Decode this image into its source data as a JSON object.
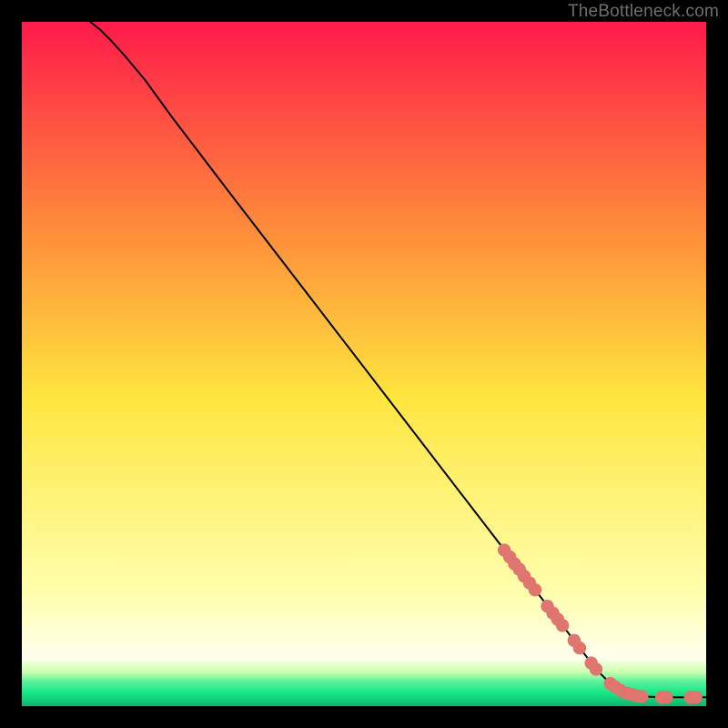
{
  "attribution": "TheBottleneck.com",
  "colors": {
    "top": "#ff1a4b",
    "mid_upper": "#ff8b3a",
    "mid": "#ffe63f",
    "mid_lower_pale": "#ffffb0",
    "green_band": "#17e887",
    "dark_green": "#0cb56a",
    "marker": "#e0746f",
    "marker_stroke": "#c05b57",
    "line": "#000000"
  },
  "chart_data": {
    "type": "line",
    "title": "",
    "xlabel": "",
    "ylabel": "",
    "xlim": [
      0,
      100
    ],
    "ylim": [
      0,
      100
    ],
    "grid": false,
    "legend": false,
    "line": [
      {
        "x": 10.0,
        "y": 100.0
      },
      {
        "x": 11.5,
        "y": 98.8
      },
      {
        "x": 13.0,
        "y": 97.3
      },
      {
        "x": 15.0,
        "y": 95.1
      },
      {
        "x": 18.0,
        "y": 91.5
      },
      {
        "x": 22.0,
        "y": 86.0
      },
      {
        "x": 30.0,
        "y": 75.5
      },
      {
        "x": 40.0,
        "y": 62.5
      },
      {
        "x": 50.0,
        "y": 49.5
      },
      {
        "x": 60.0,
        "y": 36.5
      },
      {
        "x": 70.0,
        "y": 23.5
      },
      {
        "x": 80.0,
        "y": 10.5
      },
      {
        "x": 84.0,
        "y": 5.3
      },
      {
        "x": 86.0,
        "y": 3.3
      },
      {
        "x": 87.5,
        "y": 2.3
      },
      {
        "x": 89.0,
        "y": 1.7
      },
      {
        "x": 91.0,
        "y": 1.4
      },
      {
        "x": 94.0,
        "y": 1.3
      },
      {
        "x": 97.0,
        "y": 1.3
      },
      {
        "x": 100.0,
        "y": 1.3
      }
    ],
    "markers": [
      {
        "x": 70.5,
        "y": 22.8
      },
      {
        "x": 71.3,
        "y": 21.8
      },
      {
        "x": 72.0,
        "y": 20.8
      },
      {
        "x": 72.7,
        "y": 20.0
      },
      {
        "x": 73.4,
        "y": 19.0
      },
      {
        "x": 74.2,
        "y": 18.0
      },
      {
        "x": 75.0,
        "y": 17.0
      },
      {
        "x": 76.8,
        "y": 14.6
      },
      {
        "x": 77.6,
        "y": 13.6
      },
      {
        "x": 78.3,
        "y": 12.7
      },
      {
        "x": 79.0,
        "y": 11.8
      },
      {
        "x": 80.7,
        "y": 9.6
      },
      {
        "x": 81.5,
        "y": 8.5
      },
      {
        "x": 83.2,
        "y": 6.3
      },
      {
        "x": 83.9,
        "y": 5.4
      },
      {
        "x": 86.0,
        "y": 3.3
      },
      {
        "x": 86.7,
        "y": 2.8
      },
      {
        "x": 87.5,
        "y": 2.3
      },
      {
        "x": 88.3,
        "y": 1.9
      },
      {
        "x": 89.1,
        "y": 1.7
      },
      {
        "x": 89.8,
        "y": 1.5
      },
      {
        "x": 90.6,
        "y": 1.4
      },
      {
        "x": 93.5,
        "y": 1.3
      },
      {
        "x": 94.2,
        "y": 1.3
      },
      {
        "x": 97.7,
        "y": 1.3
      },
      {
        "x": 98.5,
        "y": 1.3
      }
    ]
  }
}
